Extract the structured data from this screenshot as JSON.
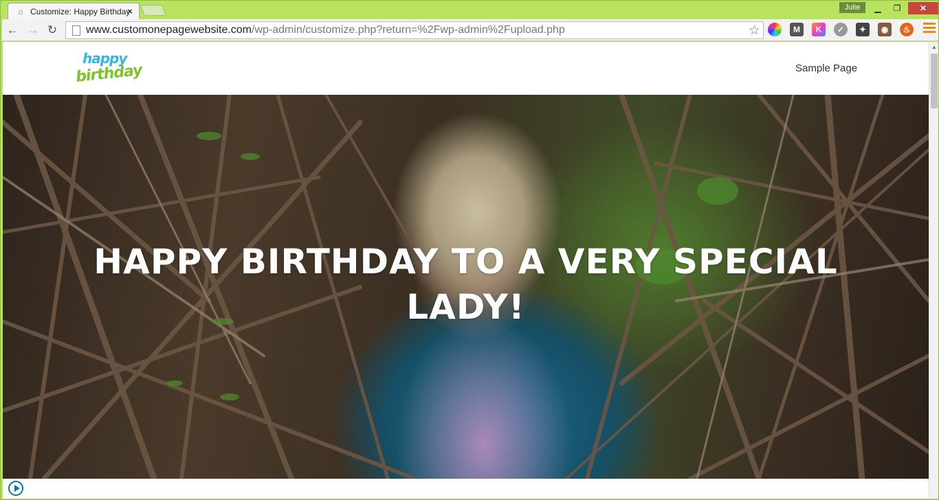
{
  "browser": {
    "tab_title": "Customize: Happy Birthday",
    "tab_favicon": "wordpress-customize-icon",
    "user_name": "Julie",
    "url_host": "www.customonepagewebsite.com",
    "url_path": "/wp-admin/customize.php?return=%2Fwp-admin%2Fupload.php",
    "window_controls": {
      "minimize": "▁",
      "maximize": "❐",
      "close": "✕"
    },
    "extensions": [
      "color-wheel-icon",
      "m-extension-icon",
      "k-extension-icon",
      "check-extension-icon",
      "puzzle-extension-icon",
      "instagram-icon",
      "fire-icon"
    ],
    "colors": {
      "frame": "#b8e35f",
      "close_button": "#c9463d"
    }
  },
  "site": {
    "logo_line1": "happy",
    "logo_line2": "birthday",
    "nav": {
      "sample_page": "Sample Page"
    },
    "hero": {
      "title": "HAPPY BIRTHDAY TO A VERY SPECIAL LADY!",
      "image": "woman-among-tree-branches-photo"
    },
    "customize_control": "customize-play-icon"
  }
}
